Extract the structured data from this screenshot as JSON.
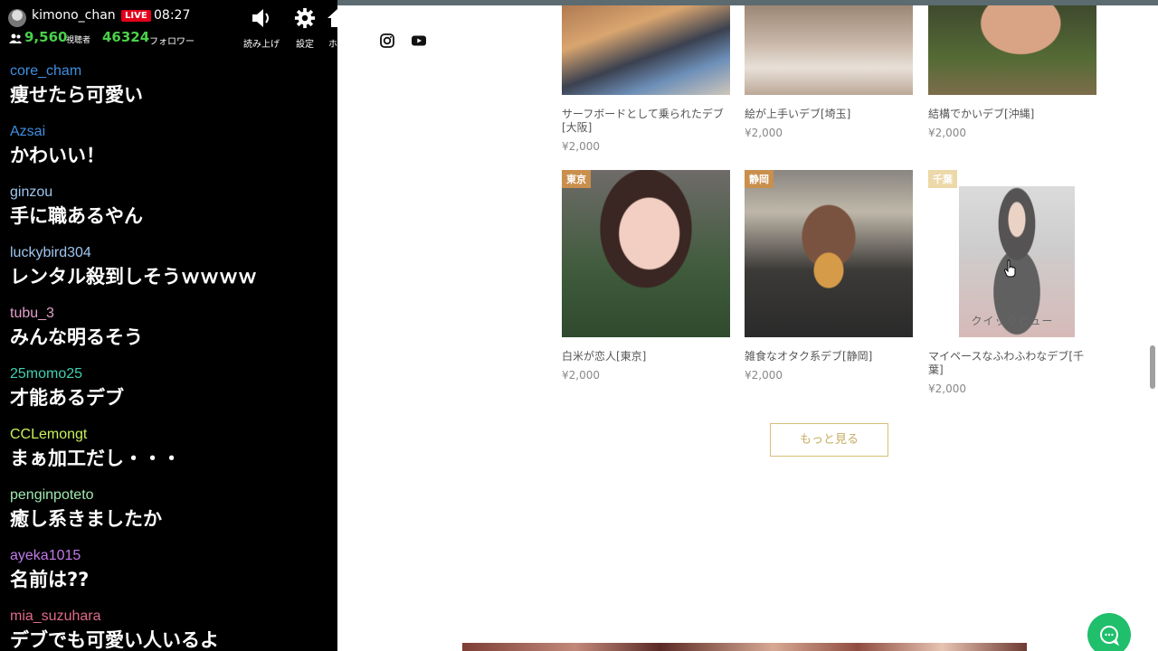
{
  "stream": {
    "channel": "kimono_chan",
    "live_label": "LIVE",
    "time": "08:27",
    "viewers": "9,560",
    "viewers_label": "視聴者",
    "followers": "46324",
    "followers_label": "フォロワー",
    "read_aloud_label": "読み上げ",
    "settings_label": "設定",
    "home_label": "ホ"
  },
  "chat": [
    {
      "user": "core_cham",
      "color": "#3f8fe0",
      "text": "痩せたら可愛い"
    },
    {
      "user": "Azsai",
      "color": "#3f8fe0",
      "text": "かわいい！"
    },
    {
      "user": "ginzou",
      "color": "#9ec6f0",
      "text": "手に職あるやん"
    },
    {
      "user": "luckybird304",
      "color": "#9ec6f0",
      "text": "レンタル殺到しそうｗｗｗｗ"
    },
    {
      "user": "tubu_3",
      "color": "#e0a0c8",
      "text": "みんな明るそう"
    },
    {
      "user": "25momo25",
      "color": "#3fd0b0",
      "text": "才能あるデブ"
    },
    {
      "user": "CCLemongt",
      "color": "#c8f05a",
      "text": "まぁ加工だし・・・"
    },
    {
      "user": "penginpoteto",
      "color": "#a0e8b0",
      "text": "癒し系きましたか"
    },
    {
      "user": "ayeka1015",
      "color": "#c07ae8",
      "text": "名前は??"
    },
    {
      "user": "mia_suzuhara",
      "color": "#e06a8a",
      "text": "デブでも可愛い人いるよ"
    }
  ],
  "products_row1": [
    {
      "title": "サーフボードとして乗られたデブ[大阪]",
      "price": "¥2,000"
    },
    {
      "title": "絵が上手いデブ[埼玉]",
      "price": "¥2,000"
    },
    {
      "title": "結構でかいデブ[沖縄]",
      "price": "¥2,000"
    }
  ],
  "products_row2": [
    {
      "tag": "東京",
      "title": "白米が恋人[東京]",
      "price": "¥2,000"
    },
    {
      "tag": "静岡",
      "title": "雑食なオタク系デブ[静岡]",
      "price": "¥2,000"
    },
    {
      "tag": "千葉",
      "title": "マイペースなふわふわなデブ[千葉]",
      "price": "¥2,000",
      "quick_view": "クイックビュー"
    }
  ],
  "more_button_label": "もっと見る",
  "colors": {
    "accent_gold": "#c6ad62",
    "chat_fab": "#1fbf6b",
    "live_red": "#e3001b",
    "viewer_green": "#4ad14a"
  },
  "icons": [
    "speaker-icon",
    "gear-icon",
    "instagram-icon",
    "youtube-icon",
    "chat-bubble-icon",
    "viewers-icon"
  ]
}
